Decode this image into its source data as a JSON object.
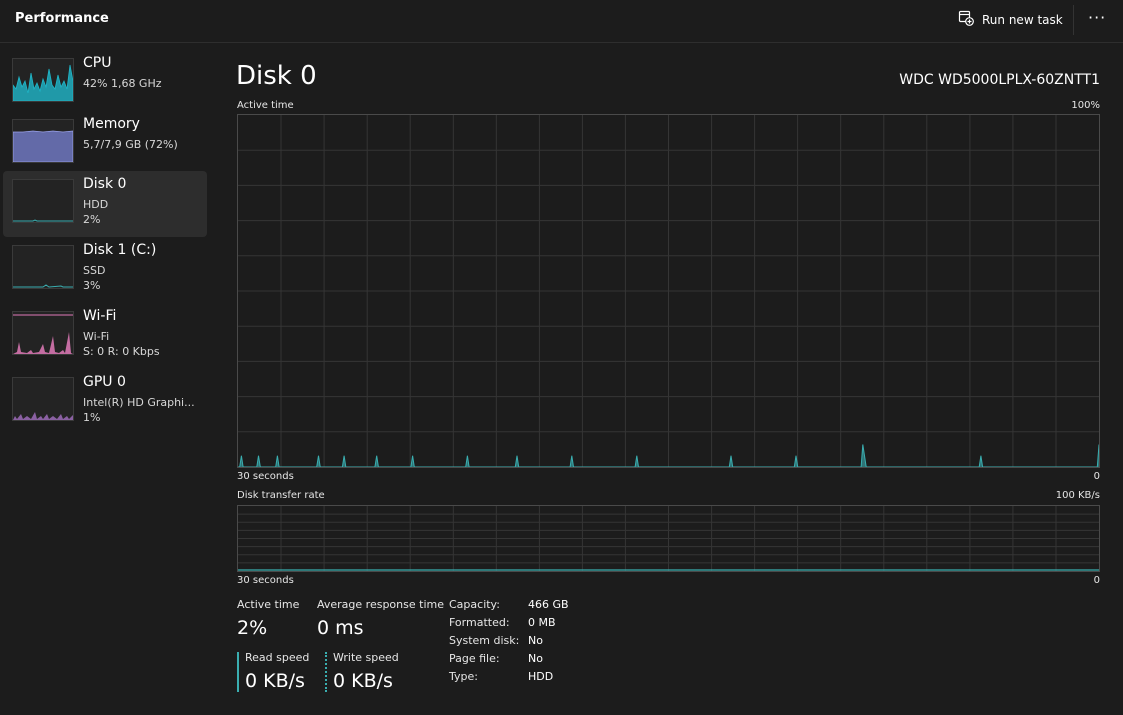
{
  "app": {
    "title": "Performance"
  },
  "toolbar": {
    "run_new_task_label": "Run new task",
    "more_icon": "more-icon"
  },
  "colors": {
    "disk": "#3aaeb0",
    "cpu": "#1fb7c9",
    "memory": "#7a83d6",
    "wifi": "#e07ab8",
    "gpu": "#a46fc2",
    "grid": "#353535",
    "background": "#1c1c1c"
  },
  "sidebar": {
    "items": [
      {
        "name": "CPU",
        "lines": [
          "42%  1,68 GHz"
        ],
        "selected": false
      },
      {
        "name": "Memory",
        "lines": [
          "5,7/7,9 GB (72%)"
        ],
        "selected": false
      },
      {
        "name": "Disk 0",
        "lines": [
          "HDD",
          "2%"
        ],
        "selected": true
      },
      {
        "name": "Disk 1 (C:)",
        "lines": [
          "SSD",
          "3%"
        ],
        "selected": false
      },
      {
        "name": "Wi-Fi",
        "lines": [
          "Wi-Fi",
          "S: 0 R: 0 Kbps"
        ],
        "selected": false
      },
      {
        "name": "GPU 0",
        "lines": [
          "Intel(R) HD Graphi...",
          "1%"
        ],
        "selected": false
      }
    ]
  },
  "main": {
    "title": "Disk 0",
    "model": "WDC WD5000LPLX-60ZNTT1",
    "active_graph": {
      "label": "Active time",
      "max_label": "100%",
      "time_label": "30 seconds",
      "min_label": "0"
    },
    "transfer_graph": {
      "label": "Disk transfer rate",
      "max_label": "100 KB/s",
      "time_label": "30 seconds",
      "min_label": "0"
    },
    "stats": {
      "active_time": {
        "label": "Active time",
        "value": "2%"
      },
      "avg_response": {
        "label": "Average response time",
        "value": "0 ms"
      },
      "read_speed": {
        "label": "Read speed",
        "value": "0 KB/s"
      },
      "write_speed": {
        "label": "Write speed",
        "value": "0 KB/s"
      }
    },
    "properties": [
      {
        "key": "Capacity:",
        "value": "466 GB"
      },
      {
        "key": "Formatted:",
        "value": "0 MB"
      },
      {
        "key": "System disk:",
        "value": "No"
      },
      {
        "key": "Page file:",
        "value": "No"
      },
      {
        "key": "Type:",
        "value": "HDD"
      }
    ]
  },
  "chart_data": {
    "type": "area",
    "ylabel": "Active time",
    "ylim": [
      0,
      100
    ],
    "series": [
      {
        "values": [
          0,
          0,
          1,
          0,
          0,
          0,
          0,
          0,
          0,
          0,
          0,
          0,
          1,
          0,
          0,
          0,
          0,
          0,
          0,
          0,
          0,
          0,
          0,
          1,
          0,
          0,
          0,
          0,
          0,
          0,
          0,
          0,
          0,
          0,
          0,
          0,
          0,
          0,
          0,
          0,
          0,
          0,
          0,
          0,
          0,
          0,
          0,
          1,
          0,
          0,
          0,
          0,
          0,
          0,
          0,
          0,
          0,
          0,
          0,
          0,
          0,
          0,
          1,
          0,
          0,
          0,
          0,
          0,
          0,
          0,
          0,
          0,
          0,
          0,
          0,
          0,
          0,
          0,
          0,
          0,
          0,
          1,
          0,
          0,
          0,
          0,
          0,
          0,
          0,
          0,
          0,
          0,
          0,
          0,
          0,
          0,
          0,
          0,
          0,
          0,
          0,
          0,
          1,
          0,
          0,
          0,
          0,
          0,
          0,
          0,
          0,
          0,
          0,
          0,
          0,
          0,
          0,
          0,
          0,
          0,
          0,
          0,
          0,
          0,
          0,
          0,
          0,
          0,
          0,
          0,
          0,
          0,
          0,
          0,
          1,
          0,
          0,
          0,
          0,
          0,
          0,
          0,
          0,
          0,
          0,
          0,
          0,
          0,
          0,
          0,
          0,
          0,
          0,
          0,
          0,
          0,
          0,
          0,
          0,
          0,
          0,
          0,
          0,
          1,
          0,
          0,
          0,
          0,
          0,
          0,
          0,
          0,
          0,
          0,
          0,
          0,
          0,
          0,
          0,
          0,
          0,
          0,
          0,
          0,
          0,
          0,
          0,
          0,
          0,
          0,
          0,
          0,
          0,
          0,
          0,
          1,
          0,
          0,
          0,
          0,
          0,
          0,
          0,
          0,
          0,
          0,
          0,
          0,
          0,
          0,
          0,
          0,
          0,
          0,
          0,
          0,
          0,
          0,
          0,
          0,
          0,
          0,
          0,
          0,
          0,
          0,
          0,
          0,
          0,
          0,
          0,
          0,
          0,
          1,
          0,
          0,
          0,
          0,
          0,
          0,
          0,
          0,
          0,
          0,
          0,
          0,
          0,
          0,
          0,
          0,
          0,
          0,
          0,
          0,
          0,
          0,
          0,
          0,
          0,
          0,
          0,
          0,
          0,
          0,
          0,
          0,
          0,
          0,
          0,
          0,
          0,
          0,
          0,
          0,
          0,
          0,
          0,
          0,
          0,
          0,
          0,
          0,
          0,
          0,
          0,
          0,
          0,
          0,
          1,
          0,
          0,
          0,
          0,
          0,
          0,
          0,
          0,
          0,
          0,
          0,
          0,
          0,
          0,
          0,
          0,
          0,
          0,
          0,
          0,
          0,
          0,
          0,
          0,
          0,
          0,
          0,
          0,
          0,
          0,
          0,
          0,
          0,
          0,
          0,
          0,
          0,
          1,
          0,
          0,
          0,
          0,
          0,
          0,
          0,
          0,
          0,
          0,
          0,
          0,
          0,
          0,
          0,
          0,
          0,
          0,
          0,
          0,
          0,
          0,
          0,
          0,
          0,
          0,
          0,
          0,
          0,
          0,
          0,
          0,
          0,
          0,
          0,
          0,
          0,
          0,
          2,
          1,
          0,
          0,
          0,
          0,
          0,
          0,
          0,
          0,
          0,
          0,
          0,
          0,
          0,
          0,
          0,
          0,
          0,
          0,
          0,
          0,
          0,
          0,
          0,
          0,
          0,
          0,
          0,
          0,
          0,
          0,
          0,
          0,
          0,
          0,
          0,
          0,
          0,
          0,
          0,
          0,
          0,
          0,
          0,
          0,
          0,
          0,
          0,
          0,
          0,
          0,
          0,
          0,
          0,
          0,
          0,
          0,
          0,
          0,
          0,
          0,
          0,
          0,
          0,
          0,
          0,
          0,
          0,
          1,
          0,
          0,
          0,
          0,
          0,
          0,
          0,
          0,
          0,
          0,
          0,
          0,
          0,
          0,
          0,
          0,
          0,
          0,
          0,
          0,
          0,
          0,
          0,
          0,
          0,
          0,
          0,
          0,
          0,
          0,
          0,
          0,
          0,
          0,
          0,
          0,
          0,
          0,
          0,
          0,
          0,
          0,
          0,
          0,
          0,
          0,
          0,
          0,
          0,
          0,
          0,
          0,
          0,
          0,
          0,
          0,
          0,
          0,
          0,
          0,
          0,
          0,
          0,
          0,
          0,
          0,
          0,
          0,
          2
        ]
      }
    ]
  }
}
